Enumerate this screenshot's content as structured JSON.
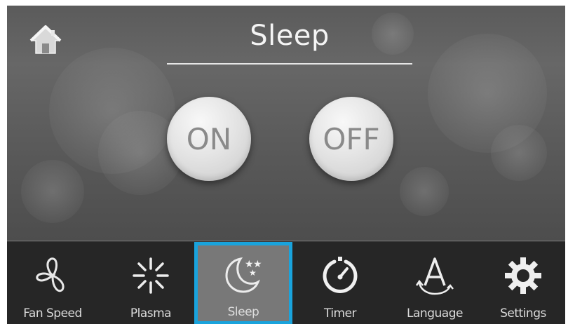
{
  "header": {
    "home_icon": "home-icon",
    "title": "Sleep"
  },
  "controls": {
    "on_label": "ON",
    "off_label": "OFF"
  },
  "nav": {
    "selected": "Sleep",
    "accent_color": "#19a3dc",
    "items": [
      {
        "label": "Fan Speed",
        "icon": "fan-icon"
      },
      {
        "label": "Plasma",
        "icon": "plasma-icon"
      },
      {
        "label": "Sleep",
        "icon": "moon-stars-icon"
      },
      {
        "label": "Timer",
        "icon": "timer-icon"
      },
      {
        "label": "Language",
        "icon": "language-icon"
      },
      {
        "label": "Settings",
        "icon": "gear-icon"
      }
    ]
  }
}
